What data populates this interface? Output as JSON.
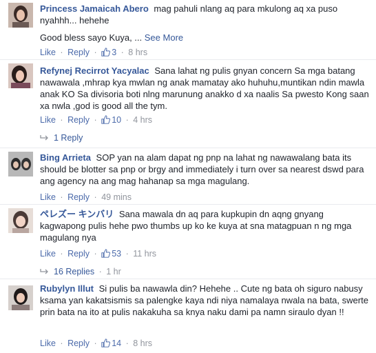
{
  "ui": {
    "like": "Like",
    "reply": "Reply",
    "dot": "·"
  },
  "comments": [
    {
      "author": "Princess Jamaicah Abero",
      "text": "mag pahuli nlang aq para mkulong aq xa puso nyahhh... hehehe",
      "text2": "Good bless sayo Kuya, ...",
      "see_more": "See More",
      "likes": "3",
      "time": "8 hrs"
    },
    {
      "author": "Refynej Recirrot Yacyalac",
      "text": "Sana lahat ng pulis gnyan concern Sa mga batang nawawala ,mhrap kya mwlan ng anak mamatay ako huhuhu,muntikan ndin mawla anak KO Sa divisoria boti nlng marunung anakko d xa naalis Sa pwesto Kong saan xa nwla ,god is good all the tym.",
      "likes": "10",
      "time": "4 hrs",
      "replies_label": "1 Reply"
    },
    {
      "author": "Bing Arrieta",
      "text": "SOP yan na alam dapat ng pnp na lahat ng nawawalang bata its should be blotter sa pnp or brgy and immediately i turn over sa nearest dswd para ang agency na ang mag hahanap sa mga magulang.",
      "time": "49 mins"
    },
    {
      "author": "ペレズー キンバリ",
      "text": "Sana mawala dn aq para kupkupin dn aqng gnyang kagwapong pulis hehe pwo thumbs up ko ke kuya at sna matagpuan n ng mga magulang nya",
      "likes": "53",
      "time": "11 hrs",
      "replies_label": "16 Replies",
      "replies_time": "1 hr"
    },
    {
      "author": "Rubylyn Illut",
      "text": "Si pulis ba nawawla din? Hehehe .. Cute ng bata oh siguro nabusy ksama yan kakatsismis sa palengke kaya ndi niya namalaya nwala na bata, swerte prin bata na ito at pulis nakakuha sa knya naku dami pa namn siraulo dyan !!",
      "likes": "14",
      "time": "8 hrs"
    }
  ],
  "colors": {
    "link": "#365899",
    "meta": "#90949c",
    "text": "#1d2129"
  },
  "icons": {
    "like": "thumbs-up-icon",
    "reply_arrow": "reply-arrow-icon"
  }
}
